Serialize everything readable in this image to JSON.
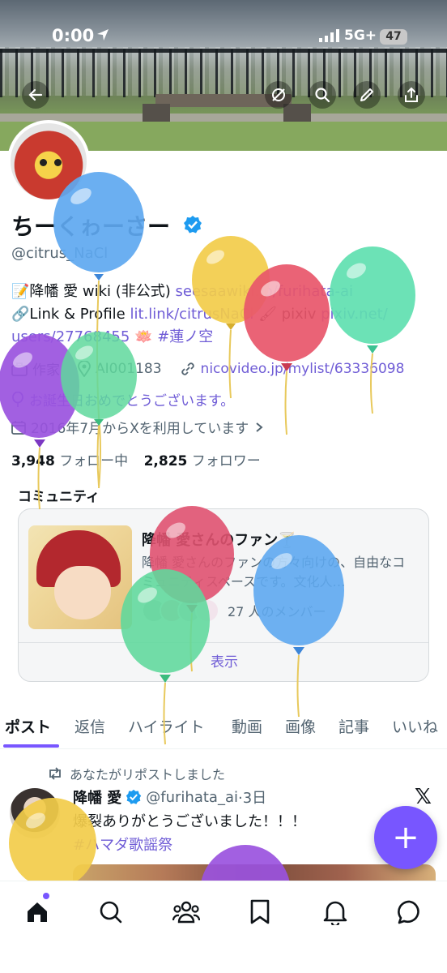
{
  "status_bar": {
    "time": "0:00",
    "network": "5G+",
    "battery": "47"
  },
  "profile": {
    "display_name": "ちーくゎーさー",
    "handle": "@citrus_NaCl",
    "bio_line1_text": "降幡 愛 wiki (非公式) ",
    "bio_line1_link": "seesaawiki.jp/furihata-ai",
    "bio_line2_text": "Link & Profile ",
    "bio_line2_link": "lit.link/citrusNaCl",
    "bio_line2_text2": " pixiv ",
    "bio_line2_link2": "pixiv.net/",
    "bio_line3_link": "users/27768455",
    "bio_line3_hashtag": "#蓮ノ空",
    "category": "作家",
    "location": "AI001183",
    "website": "nicovideo.jp/mylist/63336098",
    "birthday": "お誕生日おめでとうございます。",
    "joined": "2016年7月からXを利用しています",
    "following_count": "3,948",
    "following_label": "フォロー中",
    "followers_count": "2,825",
    "followers_label": "フォロワー"
  },
  "community": {
    "heading": "コミュニティ",
    "title": "降幡 愛さんのファン🍸",
    "description": "降幡 愛さんのファンの方々向けの、自由なコミュニティスペースです。文化人…",
    "members": "27 人のメンバー",
    "show_label": "表示"
  },
  "tabs": [
    "ポスト",
    "返信",
    "ハイライト",
    "動画",
    "画像",
    "記事",
    "いいね"
  ],
  "post": {
    "repost_label": "あなたがリポストしました",
    "author_name": "降幡 愛",
    "author_handle": "@furihata_ai",
    "time": "·3日",
    "text": "爆裂ありがとうございました！！！",
    "hashtag": "#ハマダ歌謡祭",
    "logo": "𝕏"
  },
  "fab": {
    "label": "+"
  },
  "icons": [
    "back-arrow-icon",
    "search-icon",
    "edit-icon",
    "share-icon",
    "home-icon",
    "communities-icon",
    "bookmark-icon",
    "notifications-icon",
    "messages-icon"
  ],
  "balloon_colors": [
    "#5ea8f0",
    "#f2cc4a",
    "#e8566a",
    "#5fe0b0",
    "#9a52de",
    "#e05270",
    "#5fd89c"
  ]
}
